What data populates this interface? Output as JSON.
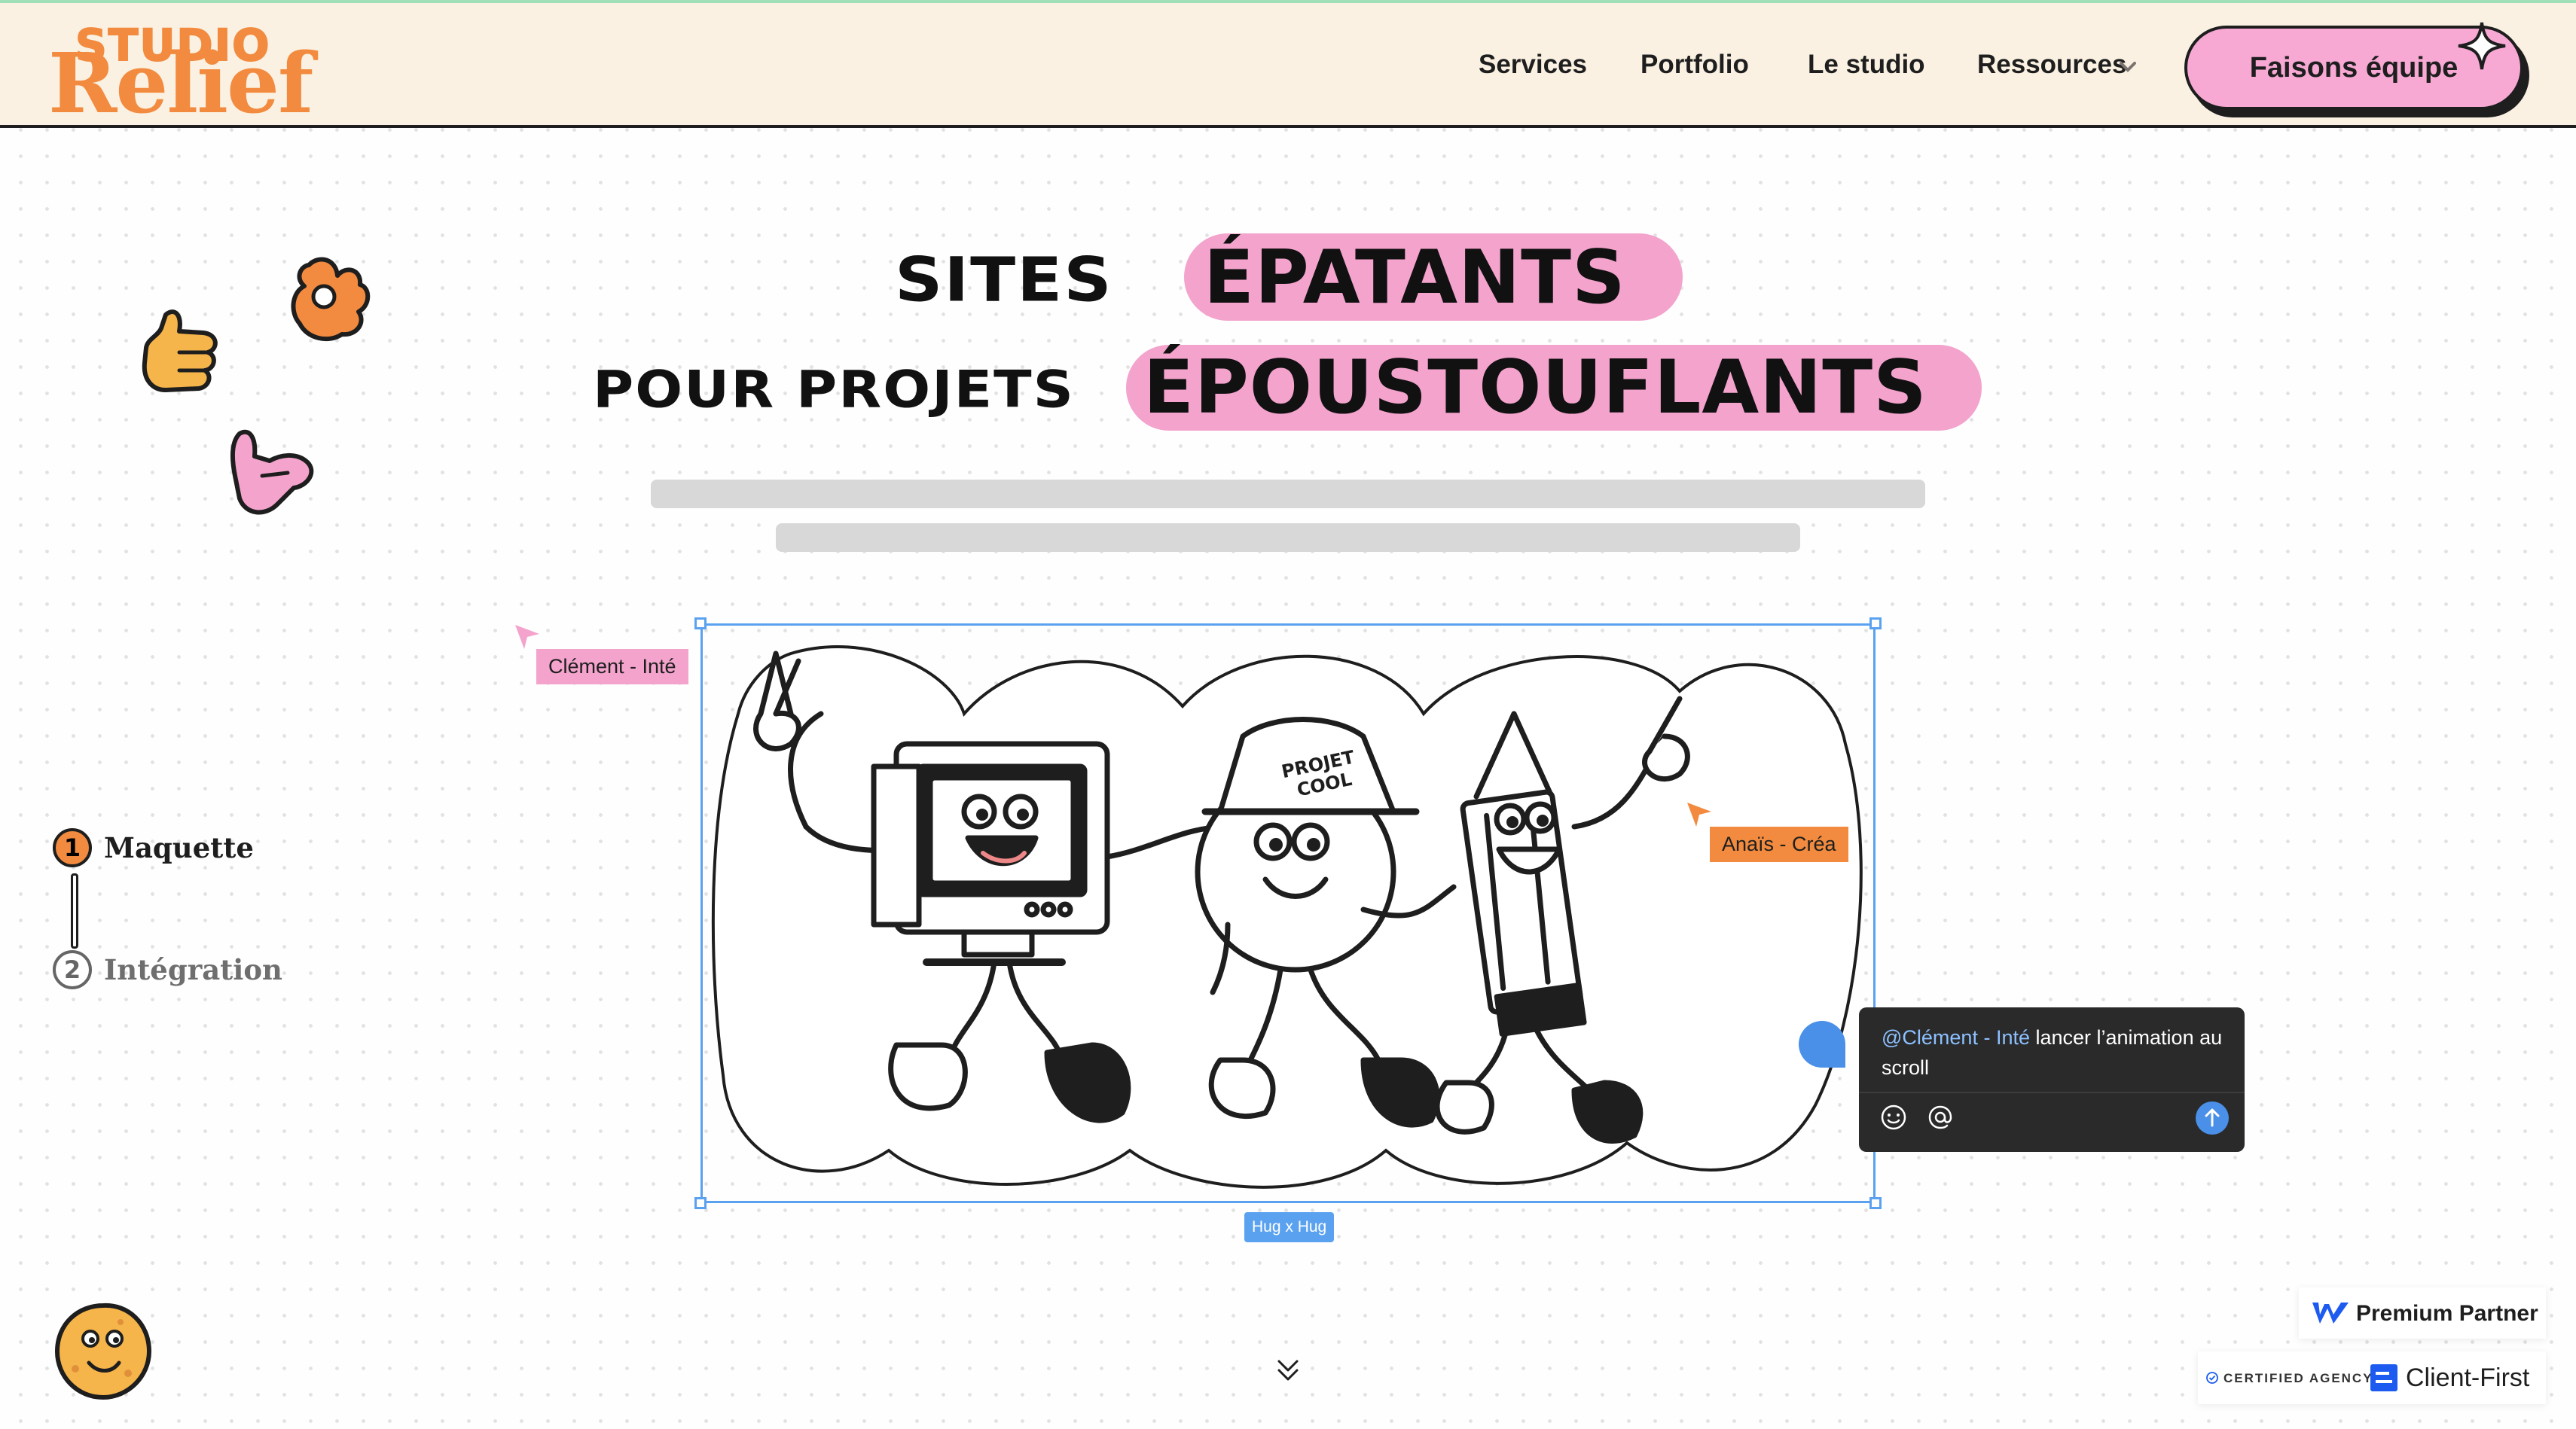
{
  "nav": {
    "logo_top": "STUDIO",
    "logo_bottom": "Relief",
    "items": [
      {
        "label": "Services"
      },
      {
        "label": "Portfolio"
      },
      {
        "label": "Le studio"
      },
      {
        "label": "Ressources"
      }
    ],
    "cta_label": "Faisons équipe"
  },
  "hero": {
    "line1_plain": "SITES",
    "line1_highlight": "ÉPATANTS",
    "line2_plain": "POUR PROJETS",
    "line2_highlight": "ÉPOUSTOUFLANTS",
    "highlight_color": "#f3a3cc"
  },
  "stepper": {
    "steps": [
      {
        "num": "1",
        "label": "Maquette",
        "active": true
      },
      {
        "num": "2",
        "label": "Intégration",
        "active": false
      }
    ]
  },
  "canvas": {
    "cursor_clement": "Clément - Inté",
    "cursor_anais": "Anaïs - Créa",
    "size_tag": "Hug x Hug",
    "hat_text_1": "PROJET",
    "hat_text_2": "COOL",
    "comment": {
      "mention": "@Clément - Inté",
      "text": " lancer l’animation au scroll"
    },
    "selection_color": "#5aa2f0"
  },
  "badges": {
    "webflow": "Premium Partner",
    "certified": "CERTIFIED AGENCY",
    "client_first": "Client-First"
  },
  "colors": {
    "brand_orange": "#f28b3f",
    "brand_pink": "#f7a9d4",
    "nav_bg": "#faf1e2",
    "dark": "#1e1e1e"
  }
}
